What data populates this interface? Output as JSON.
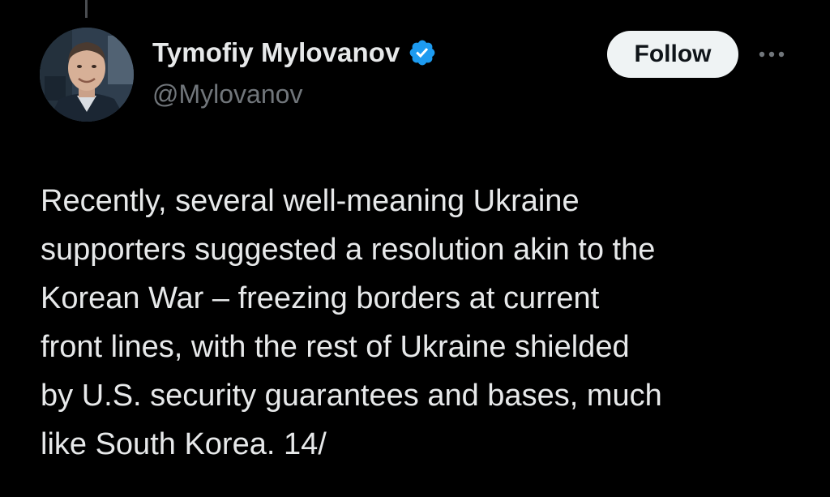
{
  "author": {
    "display_name": "Tymofiy Mylovanov",
    "handle": "@Mylovanov",
    "verified_icon": "verified-badge-icon",
    "verified_color": "#1d9bf0"
  },
  "actions": {
    "follow_label": "Follow",
    "more_icon": "more-horizontal-icon"
  },
  "tweet": {
    "lines": [
      "Recently, several well-meaning Ukraine",
      "supporters suggested a resolution akin to the",
      "Korean War – freezing borders at current",
      "front lines, with the rest of Ukraine shielded",
      "by U.S. security guarantees and bases, much",
      "like South Korea. 14/"
    ]
  },
  "colors": {
    "background": "#000000",
    "text_primary": "#e7e9ea",
    "text_secondary": "#71767b",
    "follow_bg": "#eff3f4"
  }
}
